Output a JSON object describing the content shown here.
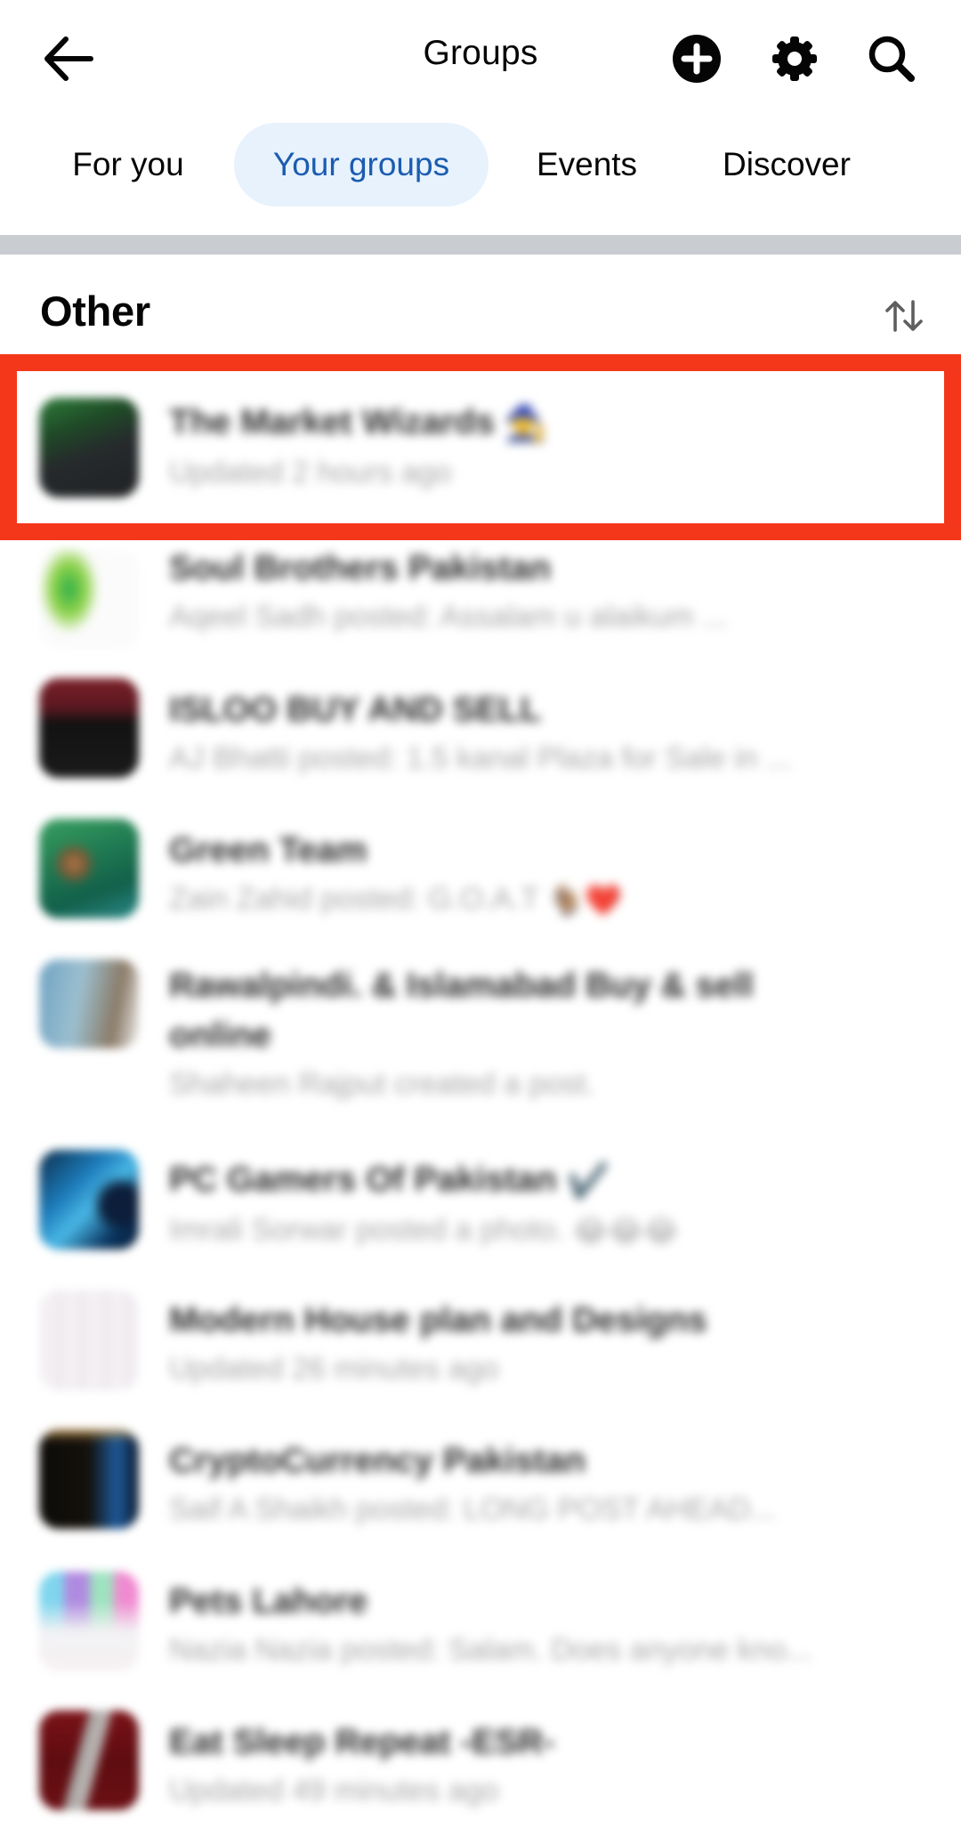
{
  "header": {
    "title": "Groups",
    "back_icon": "arrow-left-icon",
    "actions": [
      {
        "name": "create-group",
        "icon": "plus-circle-icon"
      },
      {
        "name": "settings",
        "icon": "gear-icon"
      },
      {
        "name": "search",
        "icon": "search-icon"
      }
    ]
  },
  "tabs": [
    {
      "label": "For you",
      "active": false
    },
    {
      "label": "Your groups",
      "active": true
    },
    {
      "label": "Events",
      "active": false
    },
    {
      "label": "Discover",
      "active": false
    }
  ],
  "section": {
    "title": "Other",
    "sort_icon": "sort-arrows-icon"
  },
  "colors": {
    "accent": "#1b5cb0",
    "active_tab_bg": "#e7f2fd",
    "divider": "#c9ccd1",
    "highlight": "#f4371a"
  },
  "groups": [
    {
      "title": "The Market Wizards",
      "title_emoji": "🧙",
      "subtitle": "Updated 2 hours ago",
      "highlighted": true
    },
    {
      "title": "Soul Brothers Pakistan",
      "subtitle": "Aqeel Sadh posted: Assalam u alaikum ..."
    },
    {
      "title": "ISLOO BUY AND SELL",
      "subtitle": "AJ Bhatti posted: 1.5 kanal Plaza for Sale in ..."
    },
    {
      "title": "Green Team",
      "subtitle": "Zain Zahid posted: G.O.A.T",
      "subtitle_emoji": "🐐❤️"
    },
    {
      "title": "Rawalpindi. & Islamabad Buy & sell online",
      "subtitle": "Shaheen Rajput created a post."
    },
    {
      "title": "PC Gamers Of Pakistan",
      "title_emoji": "✔️",
      "subtitle": "Imrali Sorwar posted a photo.",
      "subtitle_emoji": "😂😂😂"
    },
    {
      "title": "Modern House plan and Designs",
      "subtitle": "Updated 26 minutes ago"
    },
    {
      "title": "CryptoCurrency Pakistan",
      "subtitle": "Saif A Shaikh posted: LONG POST AHEAD..."
    },
    {
      "title": "Pets Lahore",
      "subtitle": "Nazia Nazia posted: Salam. Does anyone kno..."
    },
    {
      "title": "Eat Sleep Repeat -ESR-",
      "subtitle": "Updated 49 minutes ago"
    }
  ]
}
